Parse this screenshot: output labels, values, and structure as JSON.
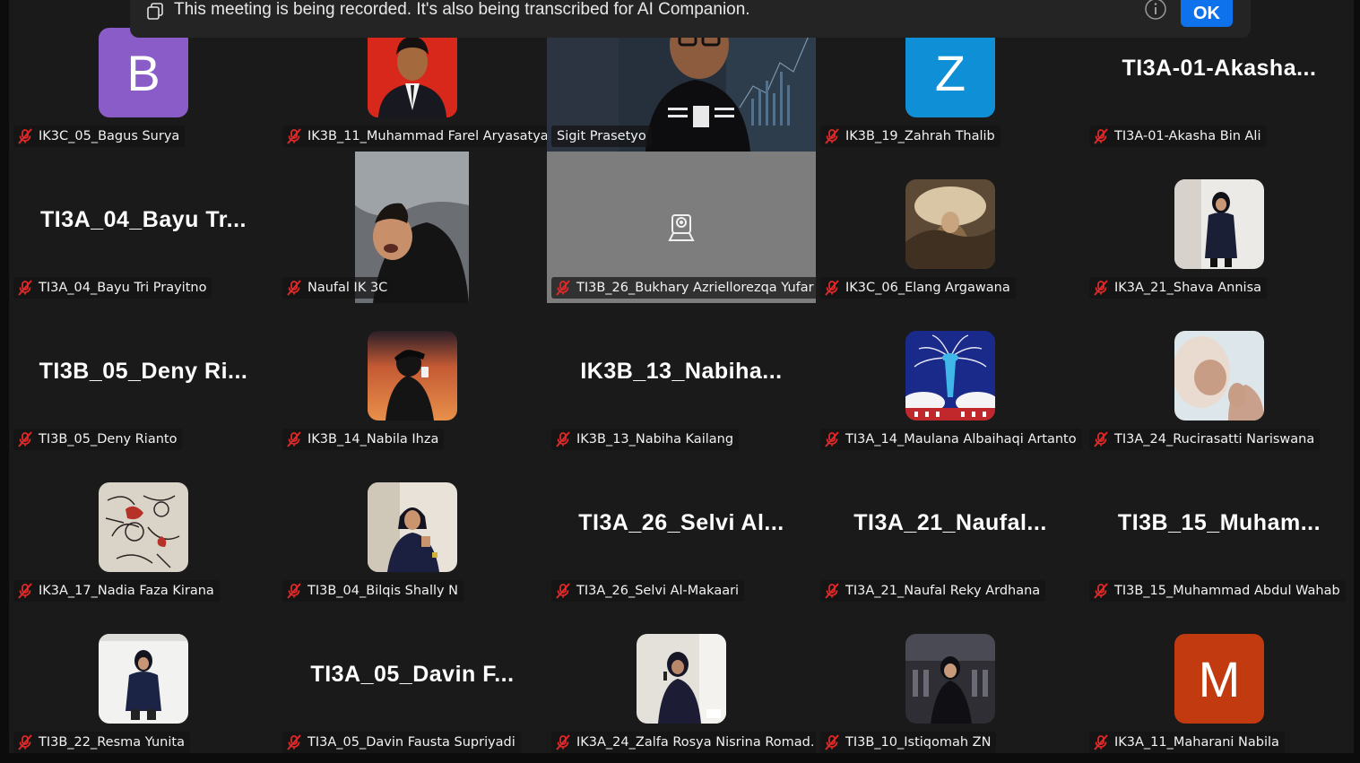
{
  "banner": {
    "text": "This meeting is being recorded. It's also being transcribed for AI Companion.",
    "ok_label": "OK",
    "info_icon": "info-icon",
    "copy_icon": "copy-icon"
  },
  "colors": {
    "active_speaker": "#23d18b",
    "ok_button": "#0e72ed",
    "mic_muted": "#e02828"
  },
  "participants": [
    {
      "name": "IK3C_05_Bagus Surya",
      "tile_type": "letter",
      "letter": "B",
      "avatar_color": "#8a5cc7"
    },
    {
      "name": "IK3B_11_Muhammad Farel Aryasatya",
      "tile_type": "photo",
      "photo": "formal-portrait-red-background"
    },
    {
      "name": "Sigit Prasetyo",
      "tile_type": "video",
      "active_speaker": true
    },
    {
      "name": "IK3B_19_Zahrah Thalib",
      "tile_type": "letter",
      "letter": "Z",
      "avatar_color": "#0e8fd6"
    },
    {
      "name": "TI3A-01-Akasha Bin Ali",
      "tile_type": "text",
      "display": "TI3A-01-Akasha..."
    },
    {
      "name": "TI3A_04_Bayu Tri Prayitno",
      "tile_type": "text",
      "display": "TI3A_04_Bayu  Tr..."
    },
    {
      "name": "Naufal IK 3C",
      "tile_type": "video"
    },
    {
      "name": "TI3B_26_Bukhary Azriellorezqa Yufar",
      "tile_type": "camera-off"
    },
    {
      "name": "IK3C_06_Elang Argawana",
      "tile_type": "photo",
      "photo": "painting"
    },
    {
      "name": "IK3A_21_Shava Annisa",
      "tile_type": "photo",
      "photo": "portrait-standing"
    },
    {
      "name": "TI3B_05_Deny Rianto",
      "tile_type": "text",
      "display": "TI3B_05_Deny  Ri..."
    },
    {
      "name": "IK3B_14_Nabila Ihza",
      "tile_type": "photo",
      "photo": "silhouette-sunset"
    },
    {
      "name": "IK3B_13_Nabiha Kailang",
      "tile_type": "text",
      "display": "IK3B_13_Nabiha..."
    },
    {
      "name": "TI3A_14_Maulana Albaihaqi Artanto",
      "tile_type": "photo",
      "photo": "tower-illustration"
    },
    {
      "name": "TI3A_24_Rucirasatti Nariswana",
      "tile_type": "photo",
      "photo": "selfie-hijab"
    },
    {
      "name": "IK3A_17_Nadia Faza Kirana",
      "tile_type": "photo",
      "photo": "sketch-art"
    },
    {
      "name": "TI3B_04_Bilqis Shally N",
      "tile_type": "photo",
      "photo": "portrait-jacket"
    },
    {
      "name": "TI3A_26_Selvi Al-Makaari",
      "tile_type": "text",
      "display": "TI3A_26_Selvi  Al..."
    },
    {
      "name": "TI3A_21_Naufal Reky Ardhana",
      "tile_type": "text",
      "display": "TI3A_21_Naufal..."
    },
    {
      "name": "TI3B_15_Muhammad Abdul Wahab",
      "tile_type": "text",
      "display": "TI3B_15_Muham..."
    },
    {
      "name": "TI3B_22_Resma Yunita",
      "tile_type": "photo",
      "photo": "portrait-white-room"
    },
    {
      "name": "TI3A_05_Davin Fausta Supriyadi",
      "tile_type": "text",
      "display": "TI3A_05_Davin  F..."
    },
    {
      "name": "IK3A_24_Zalfa Rosya Nisrina Romad...",
      "tile_type": "photo",
      "photo": "speaking-microphone"
    },
    {
      "name": "TI3B_10_Istiqomah ZN",
      "tile_type": "photo",
      "photo": "portrait-dark-hall"
    },
    {
      "name": "IK3A_11_Maharani Nabila",
      "tile_type": "letter",
      "letter": "M",
      "avatar_color": "#c23a10"
    }
  ]
}
